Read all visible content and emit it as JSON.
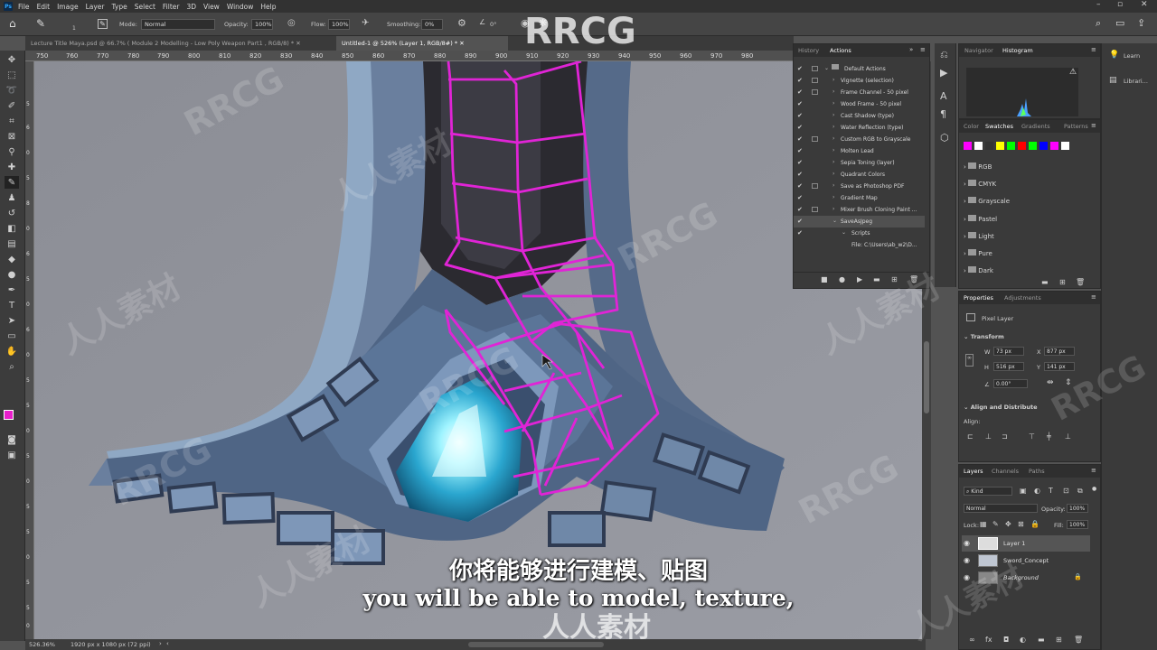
{
  "menubar": {
    "logo": "Ps",
    "items": [
      "File",
      "Edit",
      "Image",
      "Layer",
      "Type",
      "Select",
      "Filter",
      "3D",
      "View",
      "Window",
      "Help"
    ]
  },
  "options": {
    "mode_label": "Mode:",
    "mode_value": "Normal",
    "opacity_label": "Opacity:",
    "opacity_value": "100%",
    "flow_label": "Flow:",
    "flow_value": "100%",
    "smoothing_label": "Smoothing:",
    "smoothing_value": "0%",
    "angle_value": "0°",
    "brush_size": "1"
  },
  "tabs": [
    {
      "label": "Lecture Title Maya.psd @ 66.7% ( Module 2 Modelling - Low Poly Weapon Part1",
      "suffix": ", RGB/8) *"
    },
    {
      "label": "Untitled-1 @ 526% (Layer 1, RGB/8#) *"
    }
  ],
  "ruler": {
    "top": [
      "750",
      "760",
      "770",
      "780",
      "790",
      "800",
      "810",
      "820",
      "830",
      "840",
      "850",
      "860",
      "870",
      "880",
      "890",
      "900",
      "910",
      "920",
      "930",
      "940",
      "950",
      "960",
      "970",
      "980"
    ],
    "left": [
      "5",
      "6",
      "0",
      "5",
      "8",
      "0",
      "6",
      "5",
      "0",
      "6",
      "0",
      "5",
      "5",
      "0",
      "5",
      "0",
      "5",
      "5",
      "0",
      "5",
      "5",
      "0",
      "5",
      "0"
    ]
  },
  "history_panel": {
    "tabs": [
      "History",
      "Actions"
    ],
    "actions": [
      {
        "label": "Default Actions",
        "type": "folder"
      },
      {
        "label": "Vignette (selection)"
      },
      {
        "label": "Frame Channel - 50 pixel"
      },
      {
        "label": "Wood Frame - 50 pixel"
      },
      {
        "label": "Cast Shadow (type)"
      },
      {
        "label": "Water Reflection (type)"
      },
      {
        "label": "Custom RGB to Grayscale"
      },
      {
        "label": "Molten Lead"
      },
      {
        "label": "Sepia Toning (layer)"
      },
      {
        "label": "Quadrant Colors"
      },
      {
        "label": "Save as Photoshop PDF"
      },
      {
        "label": "Gradient Map"
      },
      {
        "label": "Mixer Brush Cloning Paint ..."
      },
      {
        "label": "SaveAsJpeg"
      },
      {
        "label": "Scripts"
      },
      {
        "label": "File: C:\\Users\\ab_w2\\D..."
      }
    ]
  },
  "navigator_panel": {
    "tabs": [
      "Navigator",
      "Histogram"
    ]
  },
  "swatches_panel": {
    "tabs": [
      "Color",
      "Swatches",
      "Gradients",
      "Patterns"
    ],
    "colors": [
      "#ff00ff",
      "#ffffff",
      "#333333",
      "#ffff00",
      "#00ff00",
      "#ff0000",
      "#00ff00",
      "#0000ff",
      "#ff00ff",
      "#ffffff"
    ],
    "folders": [
      "RGB",
      "CMYK",
      "Grayscale",
      "Pastel",
      "Light",
      "Pure",
      "Dark"
    ]
  },
  "properties_panel": {
    "tabs": [
      "Properties",
      "Adjustments"
    ],
    "kind": "Pixel Layer",
    "transform_label": "Transform",
    "w": "73 px",
    "x": "877 px",
    "h": "516 px",
    "y": "141 px",
    "angle": "0.00°",
    "align_label": "Align and Distribute",
    "align_sub": "Align:"
  },
  "layers_panel": {
    "tabs": [
      "Layers",
      "Channels",
      "Paths"
    ],
    "kind": "Kind",
    "blend": "Normal",
    "opacity_label": "Opacity:",
    "opacity": "100%",
    "lock_label": "Lock:",
    "fill_label": "Fill:",
    "fill": "100%",
    "layers": [
      {
        "name": "Layer 1"
      },
      {
        "name": "Sword_Concept"
      },
      {
        "name": "Background"
      }
    ]
  },
  "right_column": {
    "learn": "Learn",
    "libraries": "Librari..."
  },
  "status": {
    "zoom": "526.36%",
    "doc": "1920 px x 1080 px (72 ppi)"
  },
  "subtitles": {
    "zh": "你将能够进行建模、贴图",
    "en": "you will be able to model, texture,"
  },
  "watermarks": {
    "rrcg": "RRCG",
    "cn": "人人素材"
  }
}
